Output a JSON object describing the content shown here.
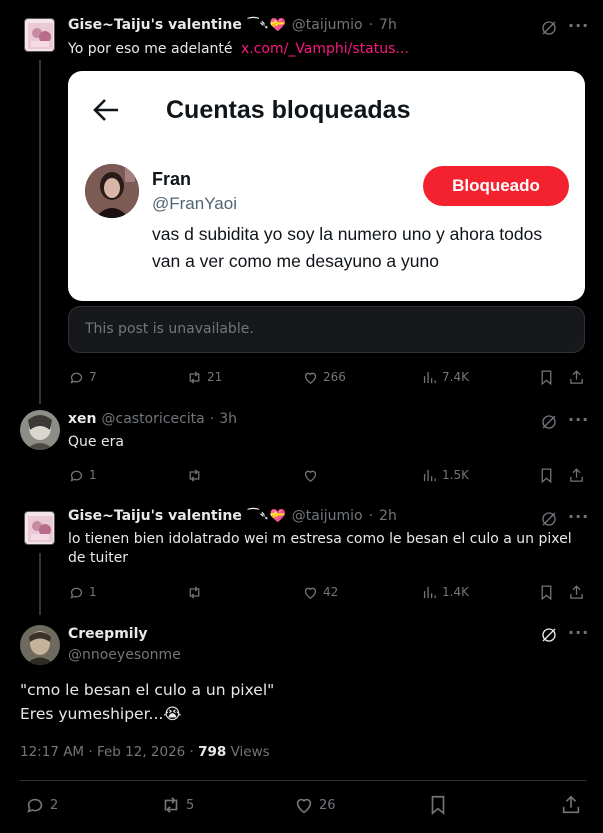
{
  "post1": {
    "display_name": "Gise~Taiju's valentine",
    "name_emoji": "⁀➴💝",
    "handle": "@taijumio",
    "time": "7h",
    "text": "Yo por eso me adelanté",
    "link": "x.com/_Vamphi/status...",
    "image": {
      "header_title": "Cuentas bloqueadas",
      "user_name": "Fran",
      "user_handle": "@FranYaoi",
      "status_button": "Bloqueado",
      "bio": "vas d subidita yo soy la numero uno y ahora todos van a ver como me desayuno a yuno"
    },
    "quote_unavailable": "This post is unavailable.",
    "replies": "7",
    "reposts": "21",
    "likes": "266",
    "views": "7.4K"
  },
  "post2": {
    "display_name": "xen",
    "handle": "@castoricecita",
    "time": "3h",
    "text": "Que era",
    "replies": "1",
    "reposts": "",
    "likes": "",
    "views": "1.5K"
  },
  "post3": {
    "display_name": "Gise~Taiju's valentine",
    "name_emoji": "⁀➴💝",
    "handle": "@taijumio",
    "time": "2h",
    "text": "lo tienen bien idolatrado wei m estresa como le besan el culo a un pixel de tuiter",
    "replies": "1",
    "reposts": "",
    "likes": "42",
    "views": "1.4K"
  },
  "main_post": {
    "display_name": "Creepmily",
    "handle": "@nnoeyesonme",
    "line1": "\"cmo le besan el culo a un pixel\"",
    "line2": "Eres yumeshiper...😭",
    "timestamp": "12:17 AM · Feb 12, 2026 · ",
    "views_count": "798",
    "views_label": " Views",
    "replies": "2",
    "reposts": "5",
    "likes": "26"
  },
  "colors": {
    "background": "#000000",
    "text": "#e7e9ea",
    "muted": "#71767b",
    "link": "#f91880",
    "blocked_button": "#f4212e"
  },
  "icons": [
    "grok-icon",
    "more-icon",
    "reply-icon",
    "repost-icon",
    "like-icon",
    "views-icon",
    "bookmark-icon",
    "share-icon",
    "back-arrow-icon"
  ]
}
